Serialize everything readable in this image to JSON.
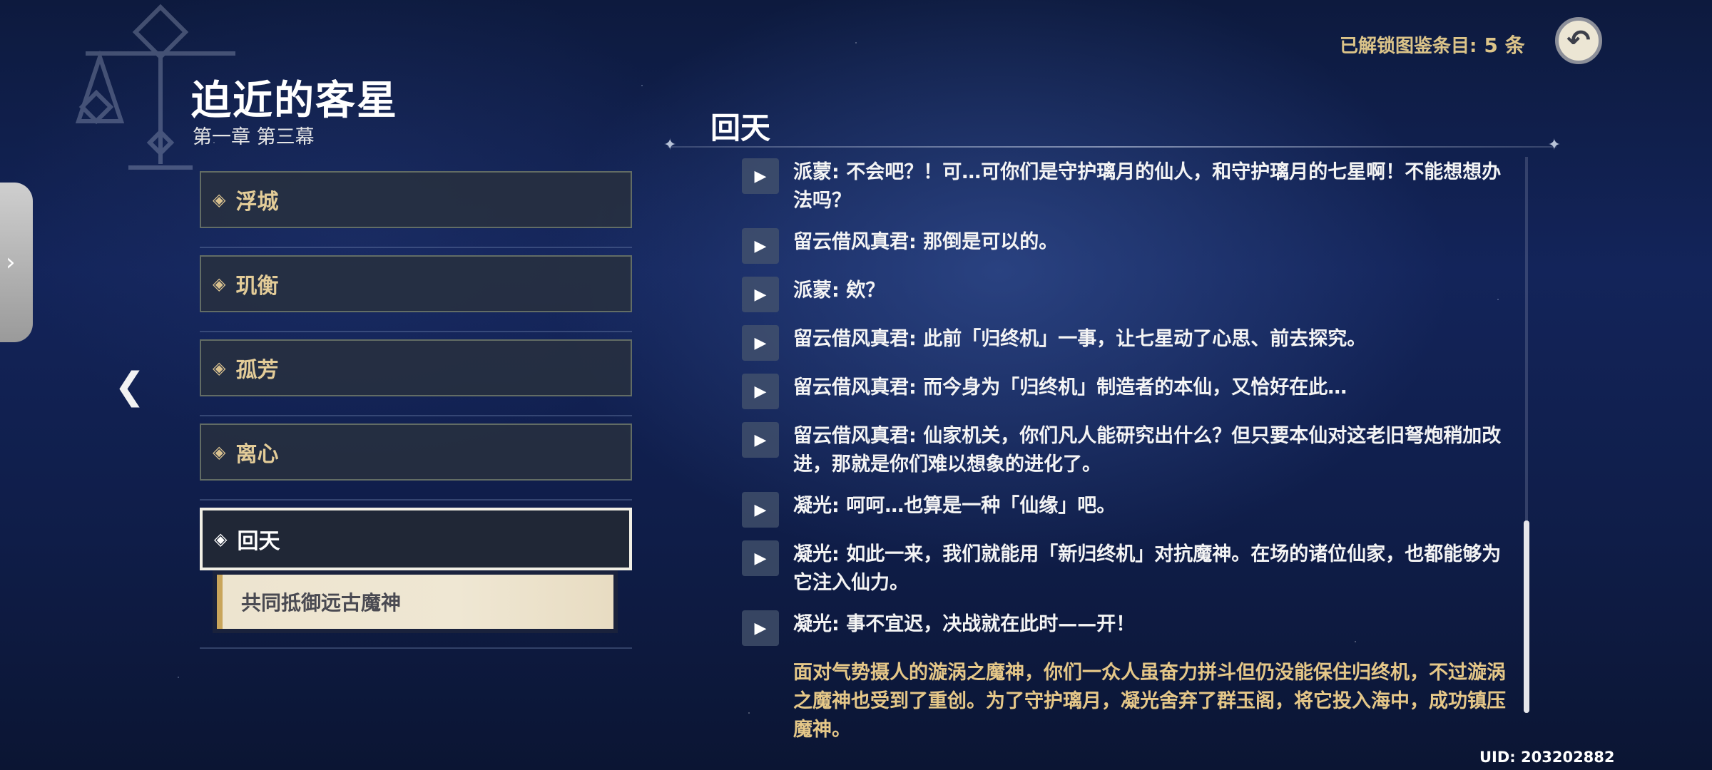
{
  "header": {
    "title": "迫近的客星",
    "subtitle": "第一章 第三幕",
    "unlock_label": "已解锁图鉴条目:",
    "unlock_count": "5 条"
  },
  "side_tab_icon": "chevron-right-icon",
  "chapters": [
    {
      "label": "浮城"
    },
    {
      "label": "玑衡"
    },
    {
      "label": "孤芳"
    },
    {
      "label": "离心"
    },
    {
      "label": "回天",
      "selected": true
    }
  ],
  "sub_item": {
    "label": "共同抵御远古魔神"
  },
  "section": {
    "title": "回天"
  },
  "dialogue": [
    "派蒙: 不会吧？！可…可你们是守护璃月的仙人，和守护璃月的七星啊！不能想想办法吗？",
    "留云借风真君: 那倒是可以的。",
    "派蒙: 欸？",
    "留云借风真君: 此前「归终机」一事，让七星动了心思、前去探究。",
    "留云借风真君: 而今身为「归终机」制造者的本仙，又恰好在此…",
    "留云借风真君: 仙家机关，你们凡人能研究出什么？但只要本仙对这老旧弩炮稍加改进，那就是你们难以想象的进化了。",
    "凝光: 呵呵…也算是一种「仙缘」吧。",
    "凝光: 如此一来，我们就能用「新归终机」对抗魔神。在场的诸位仙家，也都能够为它注入仙力。",
    "凝光: 事不宜迟，决战就在此时——开！"
  ],
  "narration": "面对气势摄人的漩涡之魔神，你们一众人虽奋力拼斗但仍没能保住归终机，不过漩涡之魔神也受到了重创。为了守护璃月，凝光舍弃了群玉阁，将它投入海中，成功镇压魔神。",
  "uid": "UID: 203202882",
  "colors": {
    "accent_gold": "#e3cc98",
    "narration": "#e5c788",
    "background": "#13245a"
  }
}
